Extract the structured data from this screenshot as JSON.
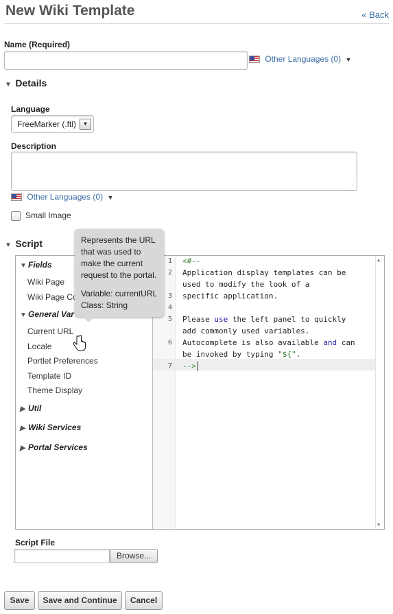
{
  "header": {
    "title": "New Wiki Template",
    "back_label": "« Back"
  },
  "name_field": {
    "label": "Name (Required)",
    "value": "",
    "other_languages": "Other Languages (0)"
  },
  "details": {
    "title": "Details",
    "language_label": "Language",
    "language_value": "FreeMarker (.ftl)",
    "description_label": "Description",
    "description_value": "",
    "other_languages": "Other Languages (0)",
    "small_image_label": "Small Image"
  },
  "script": {
    "title": "Script",
    "tree": {
      "fields_label": "Fields",
      "fields_items": [
        "Wiki Page",
        "Wiki Page Co"
      ],
      "general_label": "General Var",
      "general_items": [
        "Current URL",
        "Locale",
        "Portlet Preferences",
        "Template ID",
        "Theme Display"
      ],
      "util_label": "Util",
      "wiki_services_label": "Wiki Services",
      "portal_services_label": "Portal Services"
    },
    "tooltip": {
      "description": "Represents the URL that was used to make the current request to the portal.",
      "variable": "Variable: currentURL",
      "class": "Class: String"
    },
    "code_lines": [
      {
        "num": "1",
        "text": "<#--"
      },
      {
        "num": "2",
        "text": "Application display templates can be"
      },
      {
        "num": "",
        "text": "used to modify the look of a"
      },
      {
        "num": "3",
        "text": "specific application."
      },
      {
        "num": "4",
        "text": ""
      },
      {
        "num": "5",
        "text": "Please use the left panel to quickly"
      },
      {
        "num": "",
        "text": "add commonly used variables."
      },
      {
        "num": "6",
        "text": "Autocomplete is also available and can"
      },
      {
        "num": "",
        "text": "be invoked by typing \"${\"."
      },
      {
        "num": "7",
        "text": "-->"
      }
    ]
  },
  "script_file": {
    "label": "Script File",
    "browse_label": "Browse..."
  },
  "actions": {
    "save": "Save",
    "save_continue": "Save and Continue",
    "cancel": "Cancel"
  }
}
